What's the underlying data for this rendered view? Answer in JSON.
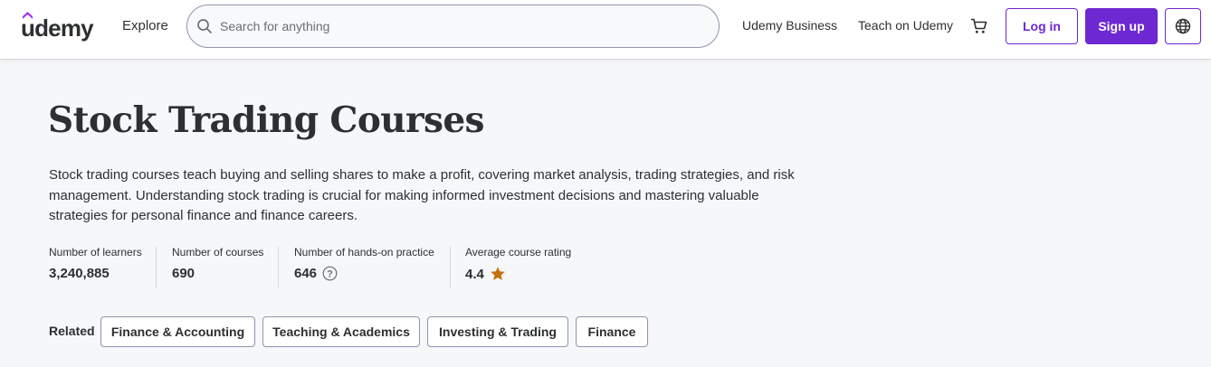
{
  "header": {
    "logo_text": "ūdemy",
    "explore_label": "Explore",
    "search_placeholder": "Search for anything",
    "business_link": "Udemy Business",
    "teach_link": "Teach on Udemy",
    "login_label": "Log in",
    "signup_label": "Sign up",
    "icons": [
      "search-icon",
      "cart-icon",
      "globe-icon"
    ]
  },
  "page": {
    "title": "Stock Trading Courses",
    "description": "Stock trading courses teach buying and selling shares to make a profit, covering market analysis, trading strategies, and risk management. Understanding stock trading is crucial for making informed investment decisions and mastering valuable strategies for personal finance and finance careers."
  },
  "stats": [
    {
      "label": "Number of learners",
      "value": "3,240,885"
    },
    {
      "label": "Number of courses",
      "value": "690"
    },
    {
      "label": "Number of hands-on practice",
      "value": "646"
    },
    {
      "label": "Average course rating",
      "value": "4.4"
    }
  ],
  "related": {
    "label": "Related",
    "tags": [
      "Finance & Accounting",
      "Teaching & Academics",
      "Investing & Trading",
      "Finance"
    ]
  },
  "colors": {
    "brand": "#6d28d2",
    "star": "#c4710d",
    "background": "#f6f7f9",
    "text": "#2d2f31"
  }
}
